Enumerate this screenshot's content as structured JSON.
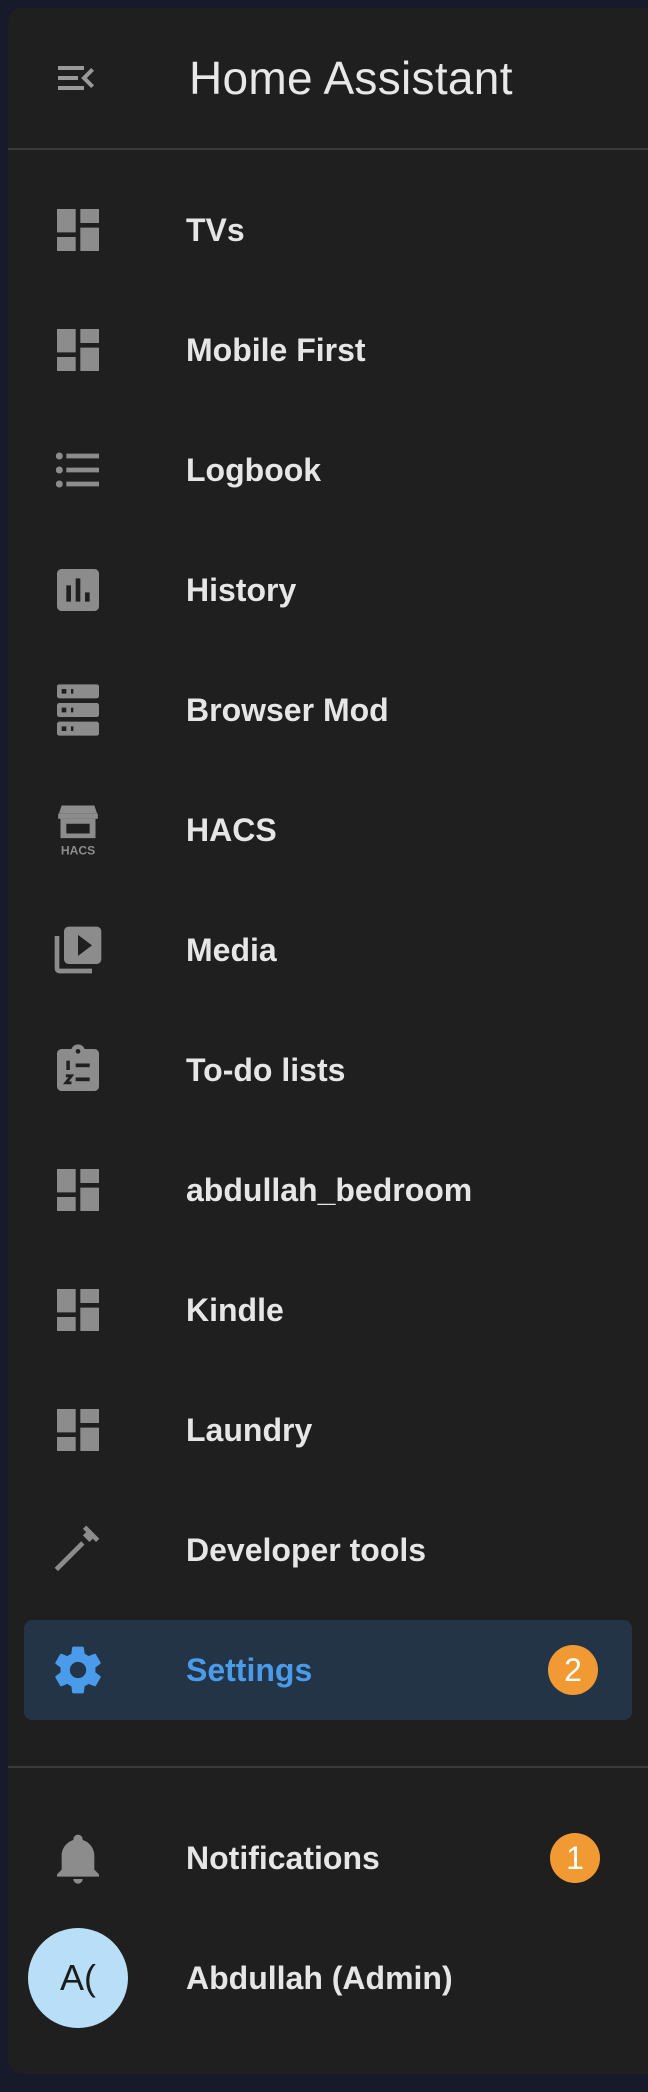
{
  "app": {
    "title": "Home Assistant"
  },
  "nav": {
    "items": [
      {
        "label": "TVs",
        "icon": "dashboard-icon"
      },
      {
        "label": "Mobile First",
        "icon": "dashboard-icon"
      },
      {
        "label": "Logbook",
        "icon": "format-list-bulleted-icon"
      },
      {
        "label": "History",
        "icon": "chart-box-icon"
      },
      {
        "label": "Browser Mod",
        "icon": "server-icon"
      },
      {
        "label": "HACS",
        "icon": "hacs-icon"
      },
      {
        "label": "Media",
        "icon": "play-box-multiple-icon"
      },
      {
        "label": "To-do lists",
        "icon": "clipboard-list-icon"
      },
      {
        "label": "abdullah_bedroom",
        "icon": "dashboard-icon"
      },
      {
        "label": "Kindle",
        "icon": "dashboard-icon"
      },
      {
        "label": "Laundry",
        "icon": "dashboard-icon"
      },
      {
        "label": "Developer tools",
        "icon": "hammer-icon"
      }
    ],
    "settings": {
      "label": "Settings",
      "badge": "2",
      "icon": "cog-icon"
    }
  },
  "bottom": {
    "notifications": {
      "label": "Notifications",
      "badge": "1",
      "icon": "bell-icon"
    },
    "user": {
      "label": "Abdullah (Admin)",
      "initials": "A("
    }
  },
  "colors": {
    "drawer": "#1f1f1f",
    "accent": "#4a9cea",
    "badge": "#f19a34",
    "icon": "#8c8c8c"
  }
}
